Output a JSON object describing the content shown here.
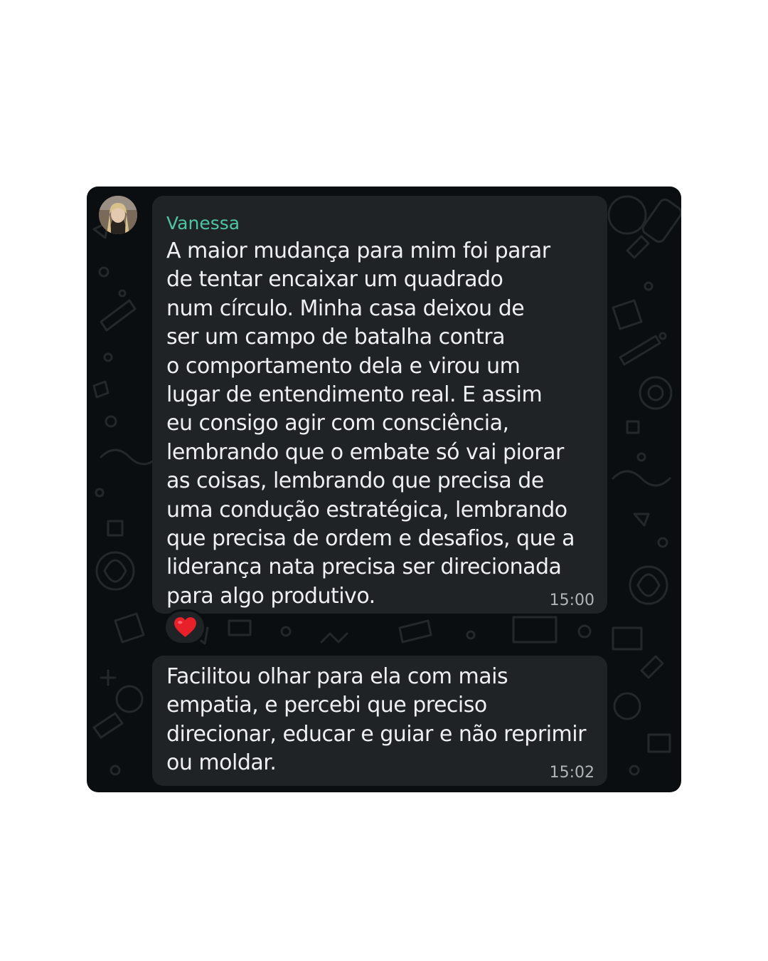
{
  "chat": {
    "messages": [
      {
        "sender": "Vanessa",
        "lines": [
          "A maior mudança para mim foi parar",
          "de tentar encaixar um quadrado",
          "num círculo. Minha casa deixou de",
          "ser um campo de batalha contra",
          "o comportamento dela e virou um",
          "lugar de entendimento real.  E assim",
          "eu consigo agir com consciência,",
          "lembrando que o embate só vai piorar",
          "as coisas, lembrando que precisa de",
          "uma condução estratégica, lembrando",
          "que precisa de ordem e desafios, que a",
          "liderança nata precisa ser direcionada",
          "para algo produtivo."
        ],
        "time": "15:00",
        "reaction": "heart-icon"
      },
      {
        "lines": [
          "Facilitou olhar para ela com mais",
          "empatia, e percebi que preciso",
          "direcionar, educar e guiar e não reprimir",
          "ou moldar."
        ],
        "time": "15:02"
      }
    ]
  },
  "colors": {
    "panel_background": "#0b0e10",
    "bubble_background": "#1f2326",
    "sender_name": "#4fc4a4",
    "message_text": "#eef0f1",
    "timestamp": "#aeb4b8",
    "heart": "#e8202a"
  }
}
